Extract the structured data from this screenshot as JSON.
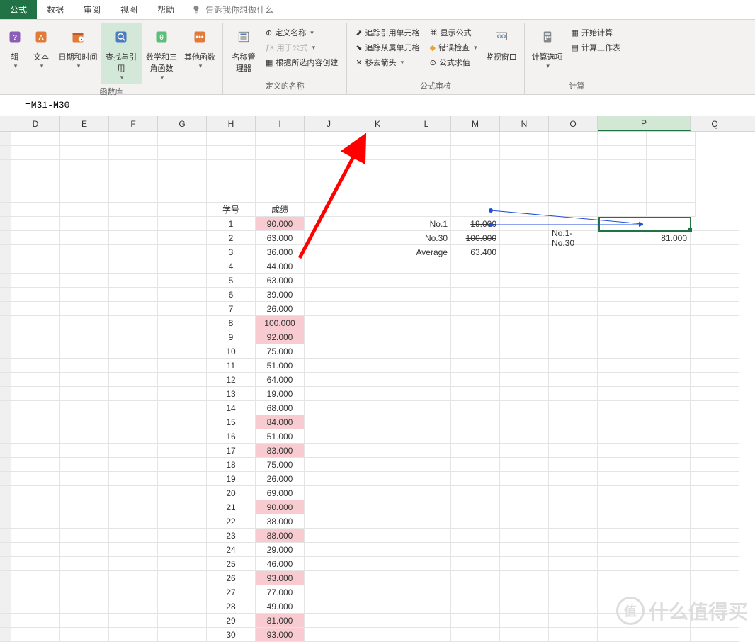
{
  "tabs": {
    "formulas": "公式",
    "data": "数据",
    "review": "审阅",
    "view": "视图",
    "help": "帮助"
  },
  "tellme": "告诉我你想做什么",
  "ribbon": {
    "edit": "辑",
    "text": "文本",
    "datetime": "日期和时间",
    "lookup": "查找与引用",
    "math": "数学和三角函数",
    "more": "其他函数",
    "namemgr": "名称管理器",
    "definename": "定义名称",
    "useinformula": "用于公式",
    "createfromsel": "根据所选内容创建",
    "traceprec": "追踪引用单元格",
    "tracedep": "追踪从属单元格",
    "removearrow": "移去箭头",
    "showformula": "显示公式",
    "errorcheck": "错误检查",
    "evaluate": "公式求值",
    "watch": "监视窗口",
    "calcopts": "计算选项",
    "calcnow": "开始计算",
    "calcsheet": "计算工作表",
    "grouplib": "函数库",
    "groupnames": "定义的名称",
    "groupaudit": "公式审核",
    "groupcalc": "计算"
  },
  "formula": "=M31-M30",
  "columns": [
    "D",
    "E",
    "F",
    "G",
    "H",
    "I",
    "J",
    "K",
    "L",
    "M",
    "N",
    "O",
    "P",
    "Q"
  ],
  "headers": {
    "studentid": "学号",
    "score": "成绩"
  },
  "table": [
    {
      "id": "1",
      "score": "90.000",
      "hl": true
    },
    {
      "id": "2",
      "score": "63.000",
      "hl": false
    },
    {
      "id": "3",
      "score": "36.000",
      "hl": false
    },
    {
      "id": "4",
      "score": "44.000",
      "hl": false
    },
    {
      "id": "5",
      "score": "63.000",
      "hl": false
    },
    {
      "id": "6",
      "score": "39.000",
      "hl": false
    },
    {
      "id": "7",
      "score": "26.000",
      "hl": false
    },
    {
      "id": "8",
      "score": "100.000",
      "hl": true
    },
    {
      "id": "9",
      "score": "92.000",
      "hl": true
    },
    {
      "id": "10",
      "score": "75.000",
      "hl": false
    },
    {
      "id": "11",
      "score": "51.000",
      "hl": false
    },
    {
      "id": "12",
      "score": "64.000",
      "hl": false
    },
    {
      "id": "13",
      "score": "19.000",
      "hl": false
    },
    {
      "id": "14",
      "score": "68.000",
      "hl": false
    },
    {
      "id": "15",
      "score": "84.000",
      "hl": true
    },
    {
      "id": "16",
      "score": "51.000",
      "hl": false
    },
    {
      "id": "17",
      "score": "83.000",
      "hl": true
    },
    {
      "id": "18",
      "score": "75.000",
      "hl": false
    },
    {
      "id": "19",
      "score": "26.000",
      "hl": false
    },
    {
      "id": "20",
      "score": "69.000",
      "hl": false
    },
    {
      "id": "21",
      "score": "90.000",
      "hl": true
    },
    {
      "id": "22",
      "score": "38.000",
      "hl": false
    },
    {
      "id": "23",
      "score": "88.000",
      "hl": true
    },
    {
      "id": "24",
      "score": "29.000",
      "hl": false
    },
    {
      "id": "25",
      "score": "46.000",
      "hl": false
    },
    {
      "id": "26",
      "score": "93.000",
      "hl": true
    },
    {
      "id": "27",
      "score": "77.000",
      "hl": false
    },
    {
      "id": "28",
      "score": "49.000",
      "hl": false
    },
    {
      "id": "29",
      "score": "81.000",
      "hl": true
    },
    {
      "id": "30",
      "score": "93.000",
      "hl": true
    }
  ],
  "summary": {
    "no1_label": "No.1",
    "no1_val": "19.000",
    "no30_label": "No.30",
    "no30_val": "100.000",
    "avg_label": "Average",
    "avg_val": "63.400",
    "diff_label": "No.1-No.30=",
    "diff_val": "81.000"
  },
  "watermark": {
    "text": "什么值得买",
    "badge": "值"
  }
}
